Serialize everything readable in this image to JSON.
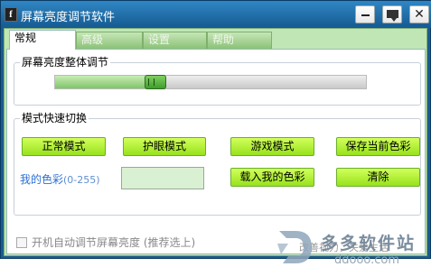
{
  "window": {
    "title": "屏幕亮度调节软件",
    "app_icon_glyph": "f"
  },
  "tabs": [
    {
      "label": "常规",
      "active": true
    },
    {
      "label": "高级",
      "active": false
    },
    {
      "label": "设置",
      "active": false
    },
    {
      "label": "帮助",
      "active": false
    }
  ],
  "brightness": {
    "group_label": "屏幕亮度整体调节",
    "level_fraction": 0.31
  },
  "modes": {
    "group_label": "模式快速切换",
    "normal_label": "正常模式",
    "eye_label": "护眼模式",
    "game_label": "游戏模式",
    "save_label": "保存当前色彩",
    "load_label": "载入我的色彩",
    "clear_label": "清除",
    "mycolor_label": "我的色彩",
    "mycolor_range": "(0-255)"
  },
  "autostart": {
    "label": "开机自动调节屏幕亮度 (推荐选上)",
    "checked": false
  },
  "slogan": "改善视力，关爱生活",
  "watermark": {
    "name": "多多软件站",
    "url": "ddooo.com"
  },
  "colors": {
    "titlebar": "#1f6fae",
    "tab_bg": "#bfe6b4",
    "button": "#b6f03a",
    "accent_text": "#2b6fd6"
  }
}
